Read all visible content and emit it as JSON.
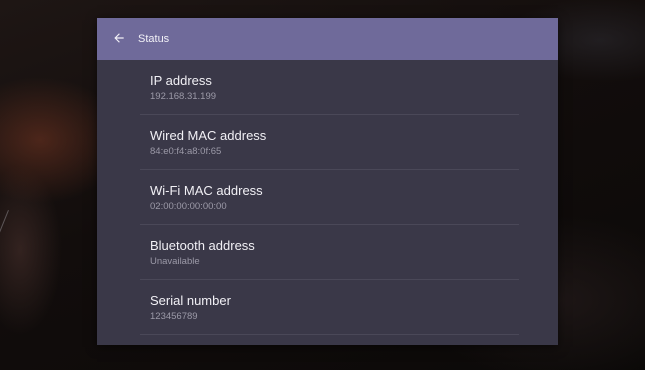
{
  "colors": {
    "app_bar": "#6f6a9a",
    "panel": "#3a3848",
    "title_text": "#f1f0f5",
    "secondary_text": "#9c9aa8"
  },
  "header": {
    "title": "Status",
    "back_icon": "arrow-back-icon"
  },
  "items": [
    {
      "label": "IP address",
      "value": "192.168.31.199"
    },
    {
      "label": "Wired MAC address",
      "value": "84:e0:f4:a8:0f:65"
    },
    {
      "label": "Wi-Fi MAC address",
      "value": "02:00:00:00:00:00"
    },
    {
      "label": "Bluetooth address",
      "value": "Unavailable"
    },
    {
      "label": "Serial number",
      "value": "123456789"
    }
  ]
}
